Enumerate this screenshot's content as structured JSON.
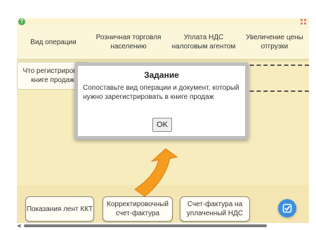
{
  "header": {
    "cells": [
      "Вид операции",
      "Розничная торговля населению",
      "Уплата НДС налоговым агентом",
      "Увеличение цены отгрузки"
    ]
  },
  "row2_label": "Что регистриров в книге продаж",
  "dialog": {
    "title": "Задание",
    "body": "Сопоставьте вид операции и документ, который нужно зарегистрировать в книге продаж",
    "ok_label": "OK"
  },
  "cards": [
    "Показания лент ККТ",
    "Корректировочный счет-фактура",
    "Счет-фактура на уплаченный НДС"
  ],
  "icons": {
    "help": "help-icon",
    "fullscreen": "fullscreen-icon",
    "arrow": "curved-arrow-icon",
    "check": "check-icon"
  },
  "colors": {
    "background": "#f6ecbd",
    "arrow": "#f39c1f",
    "check_button": "#3d8ee0"
  }
}
